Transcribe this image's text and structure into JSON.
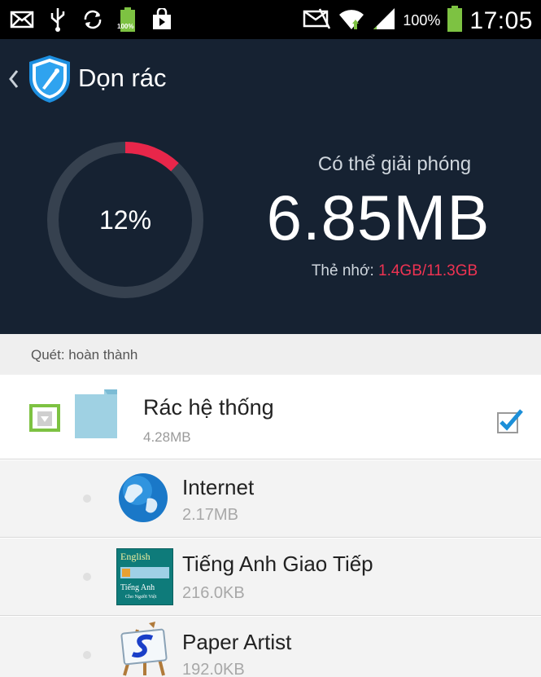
{
  "status_bar": {
    "icons_left": [
      "mail-icon",
      "usb-icon",
      "sync-icon",
      "battery-small-icon",
      "shop-bag-icon"
    ],
    "battery_small_text": "100%",
    "icons_right": [
      "nfc-icon",
      "wifi-icon",
      "signal-icon",
      "battery-icon"
    ],
    "battery_pct": "100%",
    "time": "17:05"
  },
  "header": {
    "title": "Dọn rác",
    "ring_percent": 0.12,
    "ring_label": "12%",
    "free_caption": "Có thể giải phóng",
    "free_size": "6.85MB",
    "storage_label": "Thẻ nhớ: ",
    "storage_value": "1.4GB/11.3GB"
  },
  "colors": {
    "header_bg": "#162232",
    "ring_track": "#36414f",
    "ring_fill": "#e8264a",
    "accent_red": "#ef3352",
    "highlight_green": "#7dc242"
  },
  "scan": {
    "status": "Quét: hoàn thành"
  },
  "group": {
    "title": "Rác hệ thống",
    "size": "4.28MB",
    "checked": true
  },
  "apps": [
    {
      "name": "Internet",
      "size": "2.17MB",
      "icon": "globe-icon"
    },
    {
      "name": "Tiếng Anh Giao Tiếp",
      "size": "216.0KB",
      "icon": "english-book-icon",
      "icon_text_top": "English",
      "icon_text_bottom": "Tiếng Anh",
      "icon_text_small": "Cho Người Việt"
    },
    {
      "name": "Paper Artist",
      "size": "192.0KB",
      "icon": "easel-icon"
    }
  ]
}
